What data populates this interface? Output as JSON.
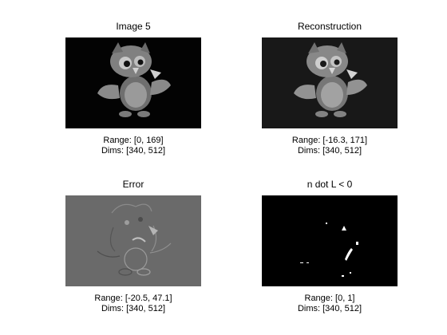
{
  "window": {
    "background": "#ffffff"
  },
  "panels": [
    {
      "title": "Image 5",
      "range": "Range: [0, 169]",
      "dims": "Dims: [340, 512]",
      "background": "#030303"
    },
    {
      "title": "Reconstruction",
      "range": "Range: [-16.3, 171]",
      "dims": "Dims: [340, 512]",
      "background": "#181818"
    },
    {
      "title": "Error",
      "range": "Range: [-20.5, 47.1]",
      "dims": "Dims: [340, 512]",
      "background": "#6a6a6a"
    },
    {
      "title": "n dot L < 0",
      "range": "Range: [0, 1]",
      "dims": "Dims: [340, 512]",
      "background": "#000000"
    }
  ]
}
